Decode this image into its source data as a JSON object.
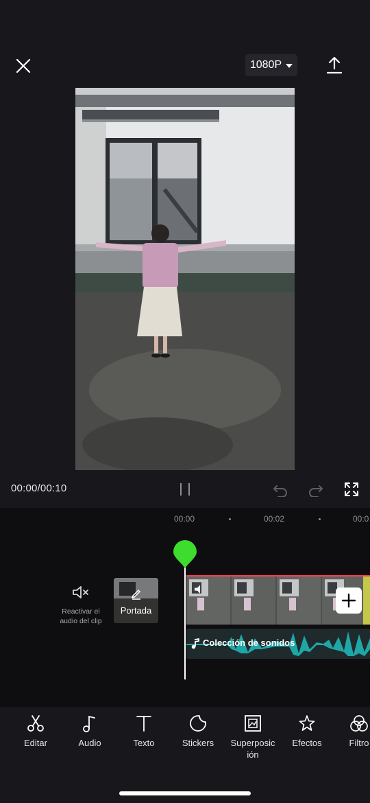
{
  "header": {
    "resolution": "1080P"
  },
  "playback": {
    "timecode": "00:00/00:10"
  },
  "timeline": {
    "ruler": [
      "00:00",
      "00:02",
      "00:0"
    ],
    "mute_label": "Reactivar el audio del clip",
    "cover_label": "Portada",
    "audio_label": "Colección de sonidos"
  },
  "toolbar": {
    "items": [
      {
        "label": "Editar",
        "icon": "scissors-icon"
      },
      {
        "label": "Audio",
        "icon": "music-note-icon"
      },
      {
        "label": "Texto",
        "icon": "text-icon"
      },
      {
        "label": "Stickers",
        "icon": "sticker-icon"
      },
      {
        "label": "Superposic ión",
        "icon": "overlay-icon"
      },
      {
        "label": "Efectos",
        "icon": "star-icon"
      },
      {
        "label": "Filtro",
        "icon": "filter-icon"
      }
    ]
  },
  "colors": {
    "playhead": "#3ddc2f",
    "accent_red": "#ff3b56",
    "waveform": "#1fa7a8"
  }
}
